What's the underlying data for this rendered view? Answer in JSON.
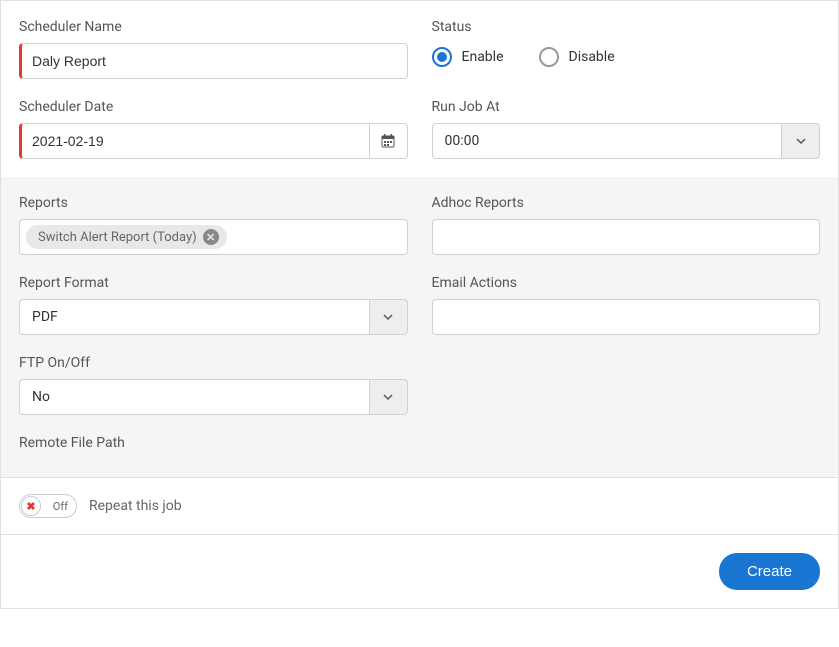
{
  "labels": {
    "scheduler_name": "Scheduler Name",
    "status": "Status",
    "scheduler_date": "Scheduler Date",
    "run_job_at": "Run Job At",
    "reports": "Reports",
    "adhoc_reports": "Adhoc Reports",
    "report_format": "Report Format",
    "email_actions": "Email Actions",
    "ftp_onoff": "FTP On/Off",
    "remote_file_path": "Remote File Path"
  },
  "values": {
    "scheduler_name": "Daly Report",
    "scheduler_date": "2021-02-19",
    "run_job_at": "00:00",
    "report_format": "PDF",
    "ftp_onoff": "No"
  },
  "status_options": {
    "enable": "Enable",
    "disable": "Disable",
    "selected": "enable"
  },
  "reports_tags": {
    "tag1": "Switch Alert Report (Today)"
  },
  "toggle": {
    "off_label": "Off",
    "text": "Repeat this job",
    "x": "✖"
  },
  "buttons": {
    "create": "Create"
  }
}
